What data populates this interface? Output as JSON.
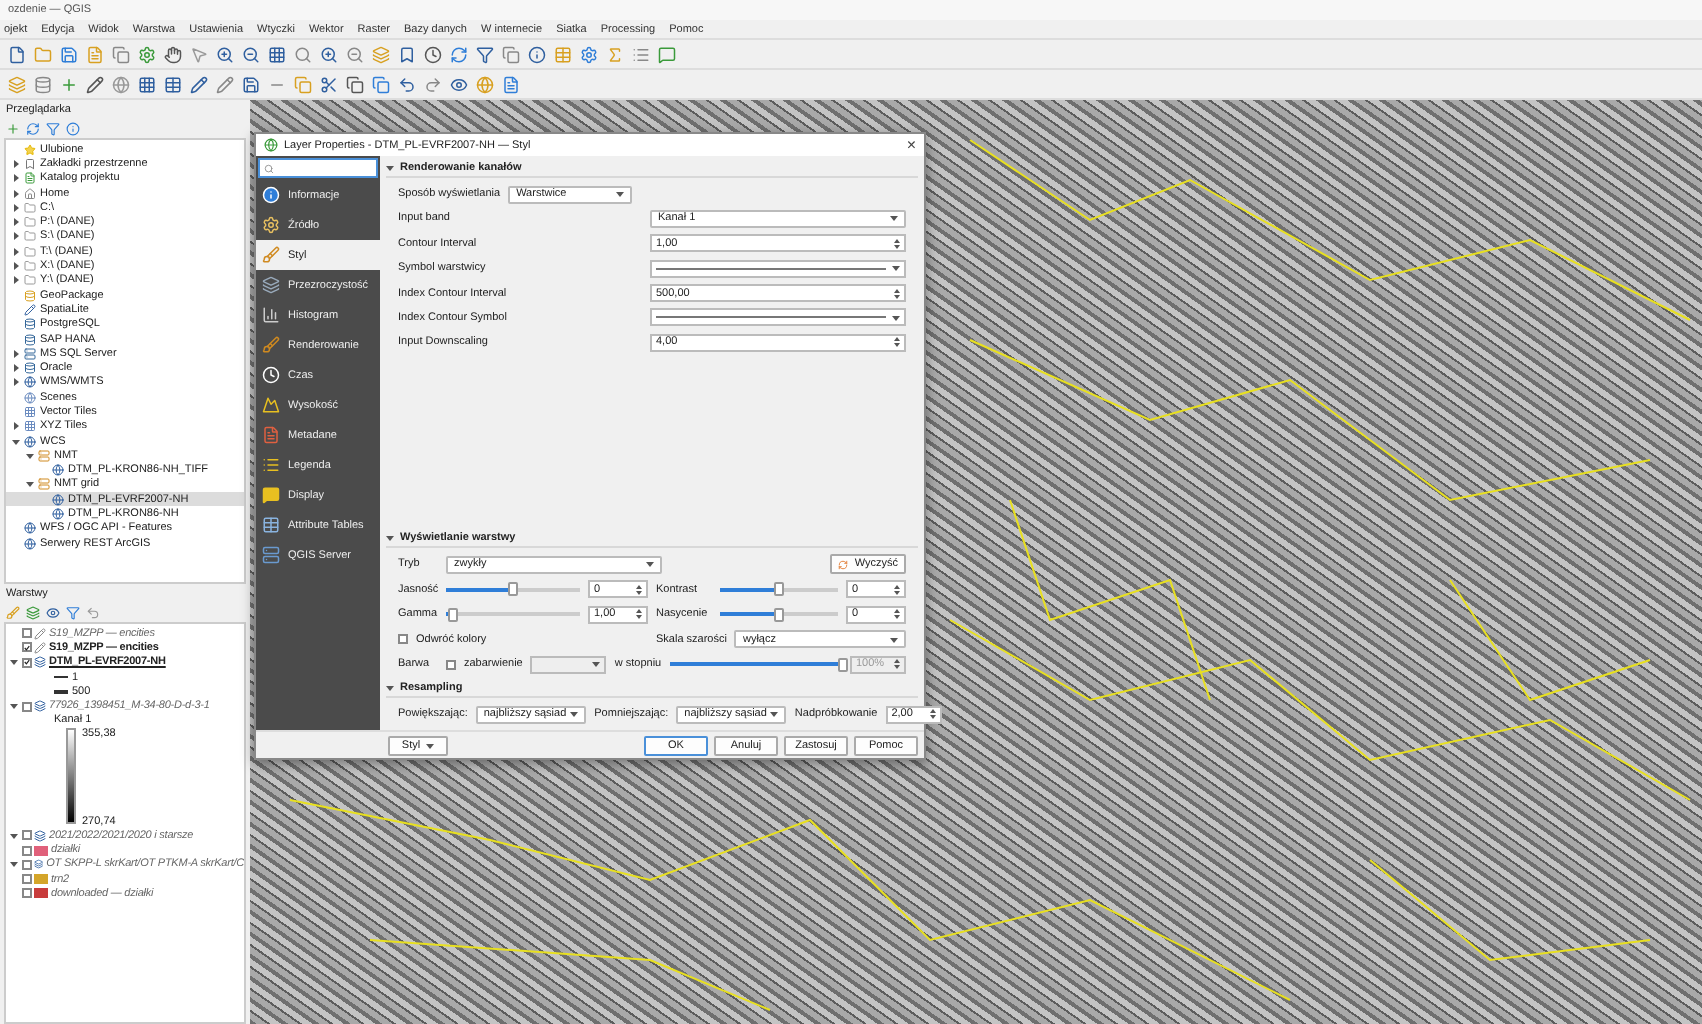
{
  "window": {
    "title": "ozdenie — QGIS"
  },
  "menu": [
    "ojekt",
    "Edycja",
    "Widok",
    "Warstwa",
    "Ustawienia",
    "Wtyczki",
    "Wektor",
    "Raster",
    "Bazy danych",
    "W internecie",
    "Siatka",
    "Processing",
    "Pomoc"
  ],
  "browser": {
    "title": "Przeglądarka",
    "items": [
      {
        "label": "Ulubione"
      },
      {
        "label": "Zakładki przestrzenne",
        "expanded": false
      },
      {
        "label": "Katalog projektu",
        "expanded": false
      },
      {
        "label": "Home",
        "expanded": false
      },
      {
        "label": "C:\\",
        "expanded": false
      },
      {
        "label": "P:\\ (DANE)",
        "expanded": false
      },
      {
        "label": "S:\\ (DANE)",
        "expanded": false
      },
      {
        "label": "T:\\ (DANE)",
        "expanded": false
      },
      {
        "label": "X:\\ (DANE)",
        "expanded": false
      },
      {
        "label": "Y:\\ (DANE)",
        "expanded": false
      },
      {
        "label": "GeoPackage"
      },
      {
        "label": "SpatiaLite"
      },
      {
        "label": "PostgreSQL"
      },
      {
        "label": "SAP HANA"
      },
      {
        "label": "MS SQL Server",
        "expanded": false
      },
      {
        "label": "Oracle",
        "expanded": false
      },
      {
        "label": "WMS/WMTS",
        "expanded": false
      },
      {
        "label": "Scenes"
      },
      {
        "label": "Vector Tiles"
      },
      {
        "label": "XYZ Tiles",
        "expanded": false
      },
      {
        "label": "WCS",
        "expanded": true,
        "children": [
          {
            "label": "NMT",
            "expanded": true,
            "children": [
              {
                "label": "DTM_PL-KRON86-NH_TIFF"
              }
            ]
          },
          {
            "label": "NMT grid",
            "expanded": true,
            "children": [
              {
                "label": "DTM_PL-EVRF2007-NH",
                "selected": true
              },
              {
                "label": "DTM_PL-KRON86-NH",
                "selected": false
              }
            ]
          }
        ]
      },
      {
        "label": "WFS / OGC API - Features"
      },
      {
        "label": "Serwery REST ArcGIS"
      }
    ]
  },
  "layers": {
    "title": "Warstwy",
    "items": [
      {
        "kind": "vector",
        "label": "S19_MZPP — encities",
        "checked": false
      },
      {
        "kind": "vector",
        "label": "S19_MZPP — encities",
        "checked": true
      },
      {
        "kind": "raster",
        "label": "DTM_PL-EVRF2007-NH",
        "checked": true,
        "expanded": true,
        "children": [
          {
            "kind": "line",
            "label": "1"
          },
          {
            "kind": "line",
            "label": "500"
          }
        ]
      },
      {
        "kind": "raster",
        "label": "77926_1398451_M-34-80-D-d-3-1",
        "checked": false,
        "expanded": true,
        "children": [
          {
            "kind": "caption",
            "label": "Kanał 1"
          },
          {
            "kind": "gradient",
            "max": "355,38",
            "min": "270,74"
          }
        ]
      },
      {
        "kind": "raster",
        "label": "2021/2022/2021/2020 i starsze",
        "checked": false,
        "expanded": true
      },
      {
        "kind": "swatch",
        "label": "działki",
        "checked": false,
        "color": "#e0607a"
      },
      {
        "kind": "raster",
        "label": "OT SKPP-L skrKart/OT PTKM-A skrKart/C",
        "checked": false,
        "expanded": true
      },
      {
        "kind": "swatch",
        "label": "trn2",
        "checked": false,
        "color": "#d4a52a"
      },
      {
        "kind": "swatch",
        "label": "downloaded — działki",
        "checked": false,
        "color": "#c83c3c"
      }
    ]
  },
  "dialog": {
    "title": "Layer Properties - DTM_PL-EVRF2007-NH — Styl",
    "close": "×",
    "sidebar": [
      {
        "label": "Informacje",
        "selected": false
      },
      {
        "label": "Źródło",
        "selected": false
      },
      {
        "label": "Styl",
        "selected": true
      },
      {
        "label": "Przezroczystość",
        "selected": false
      },
      {
        "label": "Histogram",
        "selected": false
      },
      {
        "label": "Renderowanie",
        "selected": false
      },
      {
        "label": "Czas",
        "selected": false
      },
      {
        "label": "Wysokość",
        "selected": false
      },
      {
        "label": "Metadane",
        "selected": false
      },
      {
        "label": "Legenda",
        "selected": false
      },
      {
        "label": "Display",
        "selected": false
      },
      {
        "label": "Attribute Tables",
        "selected": false
      },
      {
        "label": "QGIS Server",
        "selected": false
      }
    ],
    "band_rendering": {
      "title": "Renderowanie kanałów",
      "render_type_label": "Sposób wyświetlania",
      "render_type": "Warstwice",
      "rows": [
        {
          "kind": "combo",
          "label": "Input band",
          "value": "Kanał 1"
        },
        {
          "kind": "spin",
          "label": "Contour Interval",
          "value": "1,00"
        },
        {
          "kind": "symbol",
          "label": "Symbol warstwicy"
        },
        {
          "kind": "spin",
          "label": "Index Contour Interval",
          "value": "500,00"
        },
        {
          "kind": "symbol",
          "label": "Index Contour Symbol"
        },
        {
          "kind": "spin",
          "label": "Input Downscaling",
          "value": "4,00"
        }
      ]
    },
    "layer_rendering": {
      "title": "Wyświetlanie warstwy",
      "blend_label": "Tryb",
      "blend": "zwykły",
      "reset": "Wyczyść",
      "sliders": [
        {
          "label": "Jasność",
          "level": 0.5,
          "value": "0"
        },
        {
          "label": "Kontrast",
          "level": 0.5,
          "value": "0"
        },
        {
          "label": "Gamma",
          "level": 0.05,
          "value": "1,00"
        },
        {
          "label": "Nasycenie",
          "level": 0.5,
          "value": "0"
        }
      ],
      "invert": {
        "label": "Odwróć kolory",
        "checked": false
      },
      "grayscale_label": "Skala szarości",
      "grayscale": "wyłącz",
      "hue_label": "Barwa",
      "colorize": {
        "label": "zabarwienie",
        "checked": false
      },
      "strength_label": "w stopniu",
      "strength": {
        "level": 1,
        "value": "100%",
        "disabled": true
      }
    },
    "resampling": {
      "title": "Resampling",
      "zoomed_in_label": "Powiększając:",
      "zoomed_in": "najbliższy sąsiad",
      "zoomed_out_label": "Pomniejszając:",
      "zoomed_out": "najbliższy sąsiad",
      "oversampling_label": "Nadpróbkowanie",
      "oversampling": "2,00"
    },
    "buttons": [
      {
        "label": "Styl",
        "kind": "menu"
      },
      {
        "label": "OK",
        "kind": "default"
      },
      {
        "label": "Anuluj",
        "kind": "normal"
      },
      {
        "label": "Zastosuj",
        "kind": "normal"
      },
      {
        "label": "Pomoc",
        "kind": "normal"
      }
    ]
  }
}
